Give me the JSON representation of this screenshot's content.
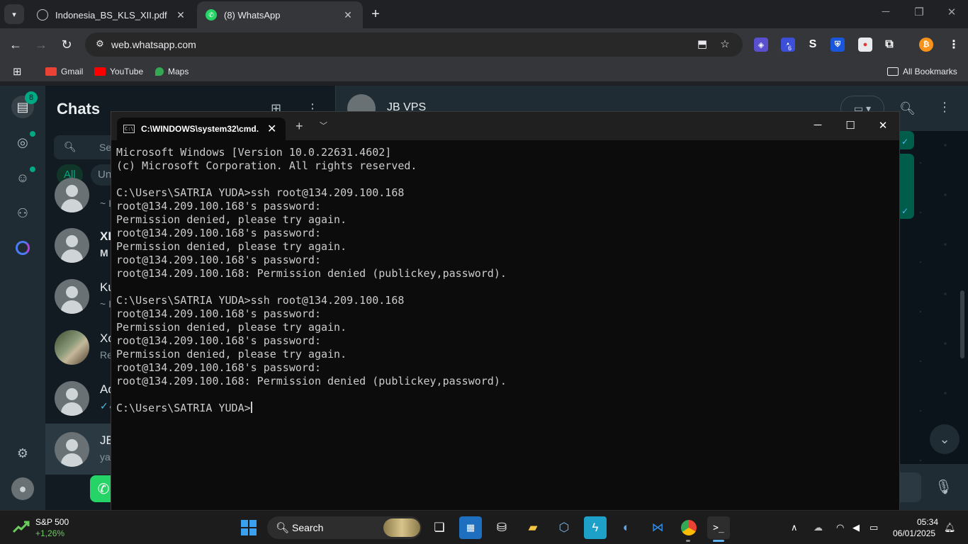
{
  "browser": {
    "tabs": [
      {
        "title": "Indonesia_BS_KLS_XII.pdf",
        "icon": "globe-icon"
      },
      {
        "title": "(8) WhatsApp",
        "icon": "whatsapp-icon"
      }
    ],
    "url": "web.whatsapp.com",
    "bookmarks": [
      {
        "label": "Gmail",
        "color": "#ea4335"
      },
      {
        "label": "YouTube",
        "color": "#ff0000"
      },
      {
        "label": "Maps",
        "color": "#34a853"
      }
    ],
    "all_bookmarks": "All Bookmarks",
    "extension_badge": "6"
  },
  "whatsapp": {
    "rail_badge": "8",
    "title": "Chats",
    "search_placeholder": "Se",
    "filters": {
      "all": "All",
      "unread": "Un"
    },
    "chats": [
      {
        "name": "",
        "message": "~ I"
      },
      {
        "name": "XI",
        "message": "M"
      },
      {
        "name": "Ku",
        "message": "~ I"
      },
      {
        "name": "Xo",
        "message": "Re"
      },
      {
        "name": "Ad",
        "message": ""
      },
      {
        "name": "JB",
        "message": "ya"
      }
    ],
    "conversation_name": "JB VPS"
  },
  "cmd": {
    "tab_title": "C:\\WINDOWS\\system32\\cmd.",
    "lines": [
      "Microsoft Windows [Version 10.0.22631.4602]",
      "(c) Microsoft Corporation. All rights reserved.",
      "",
      "C:\\Users\\SATRIA YUDA>ssh root@134.209.100.168",
      "root@134.209.100.168's password:",
      "Permission denied, please try again.",
      "root@134.209.100.168's password:",
      "Permission denied, please try again.",
      "root@134.209.100.168's password:",
      "root@134.209.100.168: Permission denied (publickey,password).",
      "",
      "C:\\Users\\SATRIA YUDA>ssh root@134.209.100.168",
      "root@134.209.100.168's password:",
      "Permission denied, please try again.",
      "root@134.209.100.168's password:",
      "Permission denied, please try again.",
      "root@134.209.100.168's password:",
      "root@134.209.100.168: Permission denied (publickey,password).",
      ""
    ],
    "prompt": "C:\\Users\\SATRIA YUDA>"
  },
  "taskbar": {
    "stock_name": "S&P 500",
    "stock_change": "+1,26%",
    "search_label": "Search",
    "time": "05:34",
    "date": "06/01/2025"
  },
  "colors": {
    "whatsapp_green": "#00a884",
    "terminal_bg": "#0c0c0c",
    "terminal_text": "#cccccc",
    "stock_up": "#6ccb5f"
  }
}
